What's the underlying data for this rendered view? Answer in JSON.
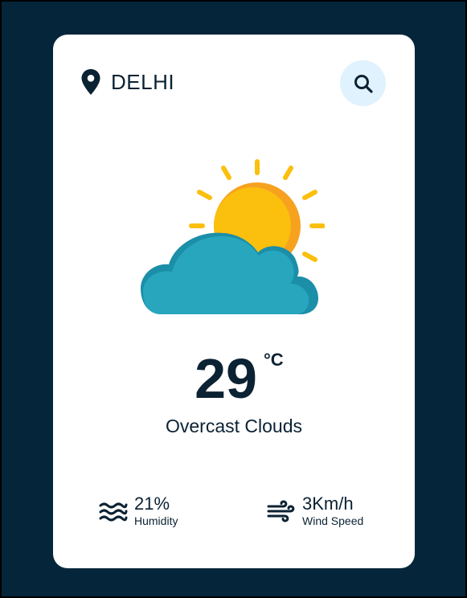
{
  "location": {
    "city": "DELHI",
    "icon": "map-pin-icon"
  },
  "search": {
    "icon": "search-icon"
  },
  "weather": {
    "icon": "sun-behind-cloud-icon",
    "temperature": "29",
    "unit": "°C",
    "description": "Overcast Clouds"
  },
  "stats": {
    "humidity": {
      "value": "21%",
      "label": "Humidity",
      "icon": "humidity-waves-icon"
    },
    "wind": {
      "value": "3Km/h",
      "label": "Wind Speed",
      "icon": "wind-icon"
    }
  },
  "colors": {
    "page_background": "#05263a",
    "card_background": "#ffffff",
    "text": "#0b2233",
    "search_button_bg": "#dff2fd",
    "sun": "#fbbf0e",
    "sun_shade": "#f6a21f",
    "cloud": "#27a6be",
    "cloud_shade": "#1b8ea8"
  }
}
